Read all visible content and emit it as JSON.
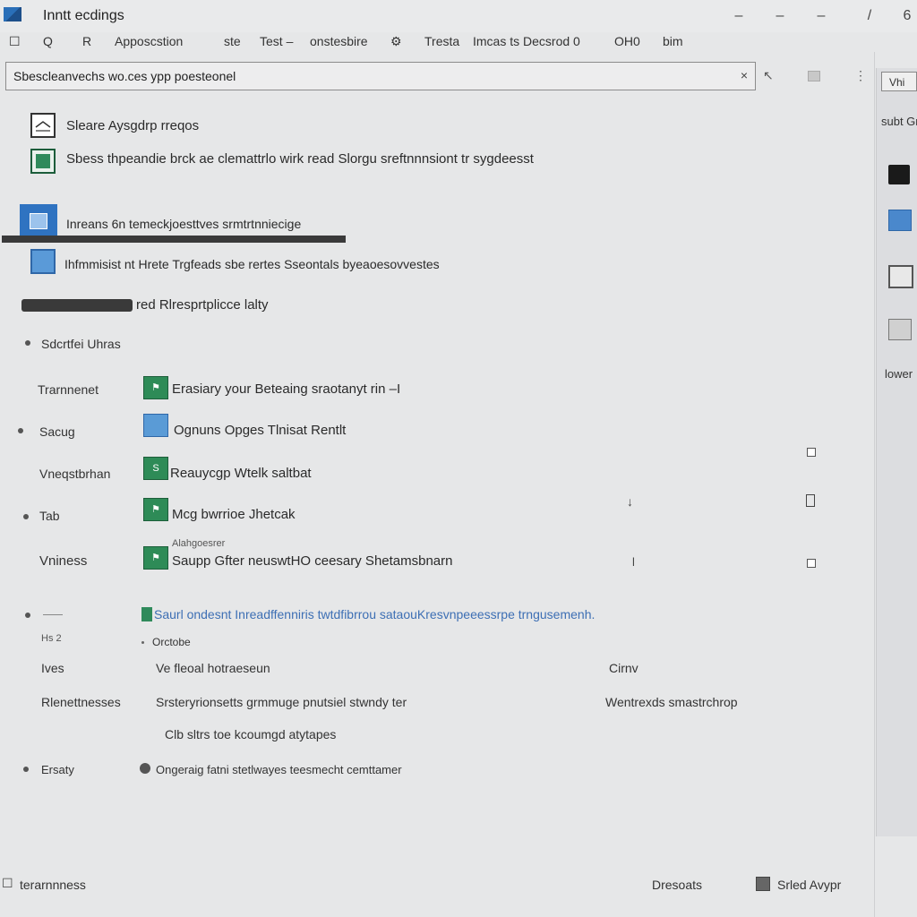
{
  "window": {
    "title": "Inntt ecdings",
    "controls": [
      "–",
      "–",
      "–",
      "/",
      "6"
    ]
  },
  "menu": {
    "items": [
      "☐",
      "Q",
      "R",
      "Apposcstion",
      "ste",
      "Test –",
      "onstesbire",
      "Tresta",
      "Imcas ts Decsrod 0",
      "OH0",
      "bim"
    ]
  },
  "search": {
    "value": "Sbescleanvechs wo.ces ypp poesteonel",
    "clear_icon": "×"
  },
  "list": {
    "row1": "Sleare Aysgdrp rreqos",
    "row2": "Sbess thpeandie brck ae clemattrlo wirk read Slorgu sreftnnnsiont tr sygdeesst",
    "row3": "Inreans 6n temeckjoesttves srmtrtnniecige",
    "row4": "Ihfmmisist nt Hrete Trgfeads sbe rertes Sseontals byeaoesovvestes",
    "row5": "red Rlresprtplicce lalty",
    "row6": "Sdcrtfei Uhras"
  },
  "details": {
    "labels": [
      "Trarnnenet",
      "Sacug",
      "Vneqstbrhan",
      "Tab",
      "Vniness"
    ],
    "values": [
      "Erasiary your Beteaing sraotanyt rin –I",
      "Ognuns Opges Tlnisat Rentlt",
      "Reauycgp Wtelk saltbat",
      "Mcg bwrrioe Jhetcak",
      "Saupp Gfter neuswtHO ceesary Shetamsbnarn"
    ],
    "note_above": "Alahgoesrer",
    "side_marker": "l",
    "link": "Saurl ondesnt Inreadffenniris twtdfibrrou sataouKresvnpeeessrpe trngusemenh.",
    "sub_left": "Hs 2",
    "sub_label": "Orctobe",
    "extra_rows": [
      {
        "label": "Ives",
        "value": "Ve fleoal hotraeseun",
        "right": "Cirnv"
      },
      {
        "label": "Rlenettnesses",
        "value": "Srsteryrionsetts grmmuge pnutsiel stwndy ter",
        "right": "Wentrexds smastrchrop"
      }
    ],
    "sub_value": "Clb sltrs toe kcoumgd atytapes",
    "bottom_label": "Ersaty",
    "bottom_value": "Ongeraig fatni stetlwayes teesmecht cemttamer"
  },
  "footer": {
    "left": "terarnnness",
    "right1": "Dresoats",
    "right2": "Srled Avypr"
  },
  "right_panel": {
    "button": "Vhi",
    "label": "subt Gr",
    "footer": "lower"
  }
}
